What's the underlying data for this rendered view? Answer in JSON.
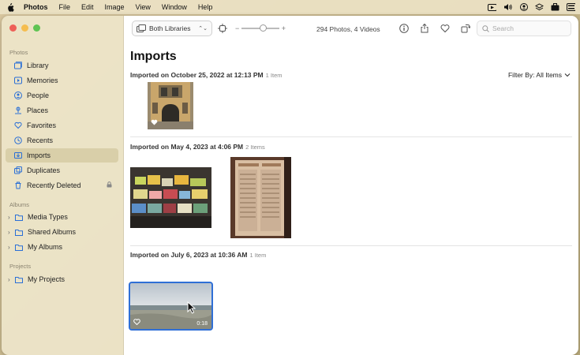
{
  "menubar": {
    "items": [
      "Photos",
      "File",
      "Edit",
      "Image",
      "View",
      "Window",
      "Help"
    ],
    "status_icons": [
      "screen-record-icon",
      "volume-icon",
      "user-circle-icon",
      "layers-icon",
      "briefcase-icon",
      "control-center-icon"
    ]
  },
  "sidebar": {
    "sections": {
      "photos": "Photos",
      "albums": "Albums",
      "projects": "Projects"
    },
    "photo_items": [
      {
        "label": "Library",
        "icon": "library-icon"
      },
      {
        "label": "Memories",
        "icon": "memories-icon"
      },
      {
        "label": "People",
        "icon": "people-icon"
      },
      {
        "label": "Places",
        "icon": "places-icon"
      },
      {
        "label": "Favorites",
        "icon": "heart-icon"
      },
      {
        "label": "Recents",
        "icon": "clock-icon"
      },
      {
        "label": "Imports",
        "icon": "import-icon",
        "selected": true
      },
      {
        "label": "Duplicates",
        "icon": "duplicates-icon"
      },
      {
        "label": "Recently Deleted",
        "icon": "trash-icon"
      }
    ],
    "album_items": [
      "Media Types",
      "Shared Albums",
      "My Albums"
    ],
    "project_items": [
      "My Projects"
    ]
  },
  "toolbar": {
    "library_select": "Both Libraries",
    "zoom_level": 0.55,
    "count": "294 Photos, 4 Videos",
    "search_placeholder": "Search"
  },
  "main": {
    "title": "Imports",
    "filter": "Filter By: All Items",
    "groups": [
      {
        "header": "Imported on October 25, 2022 at 12:13 PM",
        "items": "1 Item"
      },
      {
        "header": "Imported on May 4, 2023 at 4:06 PM",
        "items": "2 Items"
      },
      {
        "header": "Imported on July 6, 2023 at 10:36 AM",
        "items": "1 Item",
        "video_duration": "0:18"
      }
    ]
  },
  "colors": {
    "selection": "#2f6fd6",
    "sidebar_selected": "#d9cfa9"
  }
}
